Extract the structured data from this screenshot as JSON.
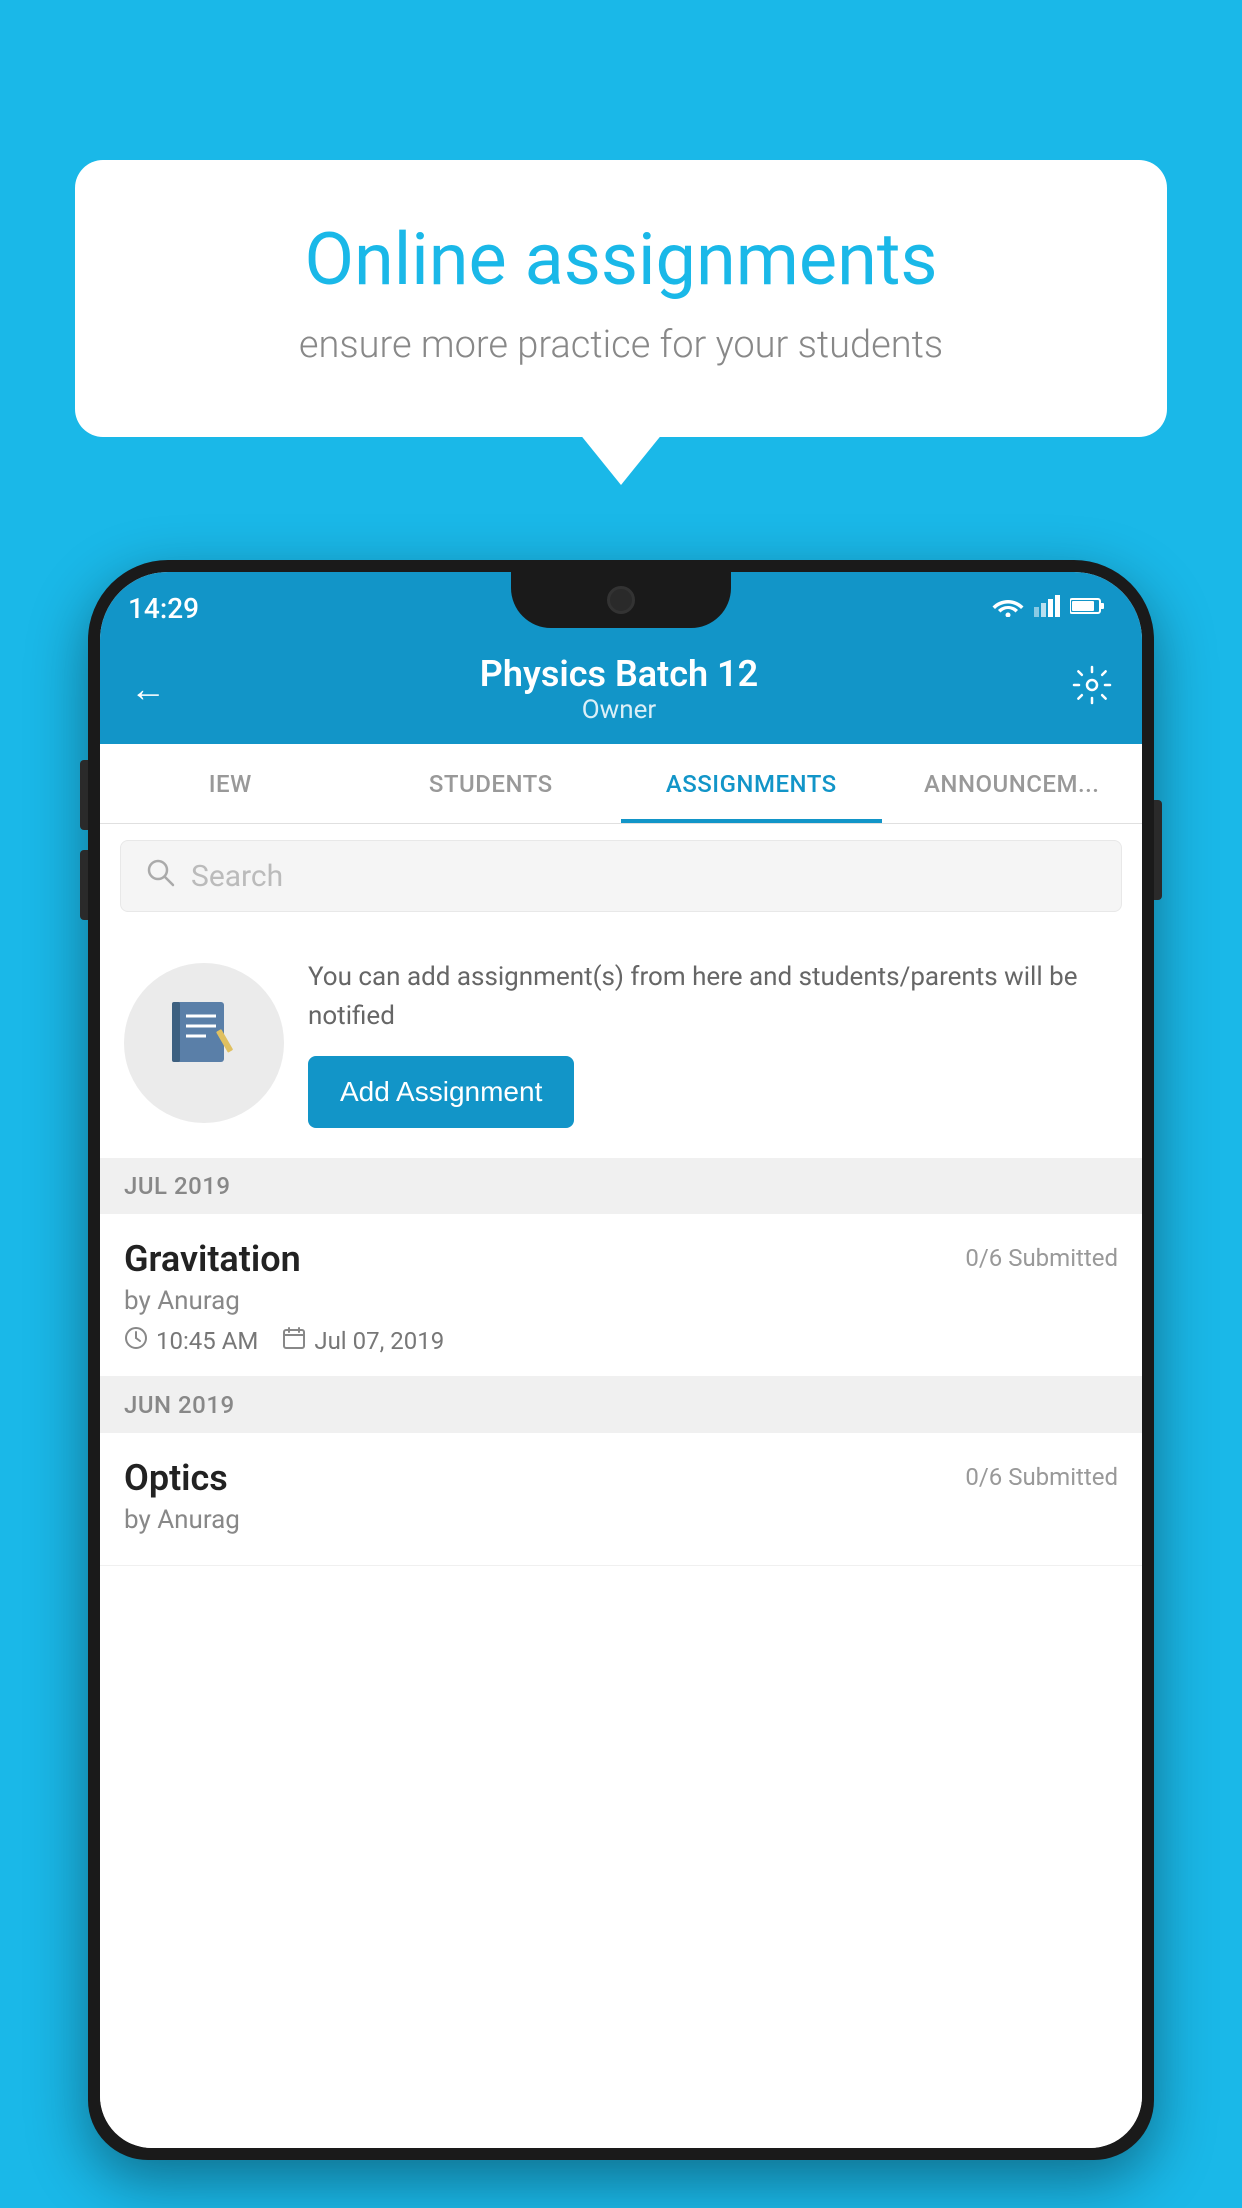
{
  "background_color": "#1ab8e8",
  "speech_bubble": {
    "title": "Online assignments",
    "subtitle": "ensure more practice for your students"
  },
  "status_bar": {
    "time": "14:29"
  },
  "header": {
    "title": "Physics Batch 12",
    "subtitle": "Owner"
  },
  "tabs": [
    {
      "label": "IEW",
      "active": false
    },
    {
      "label": "STUDENTS",
      "active": false
    },
    {
      "label": "ASSIGNMENTS",
      "active": true
    },
    {
      "label": "ANNOUNCEM...",
      "active": false
    }
  ],
  "search": {
    "placeholder": "Search"
  },
  "add_assignment": {
    "description": "You can add assignment(s) from here and students/parents will be notified",
    "button_label": "Add Assignment"
  },
  "sections": [
    {
      "label": "JUL 2019",
      "items": [
        {
          "name": "Gravitation",
          "submitted": "0/6 Submitted",
          "author": "by Anurag",
          "time": "10:45 AM",
          "date": "Jul 07, 2019"
        }
      ]
    },
    {
      "label": "JUN 2019",
      "items": [
        {
          "name": "Optics",
          "submitted": "0/6 Submitted",
          "author": "by Anurag",
          "time": "",
          "date": ""
        }
      ]
    }
  ]
}
